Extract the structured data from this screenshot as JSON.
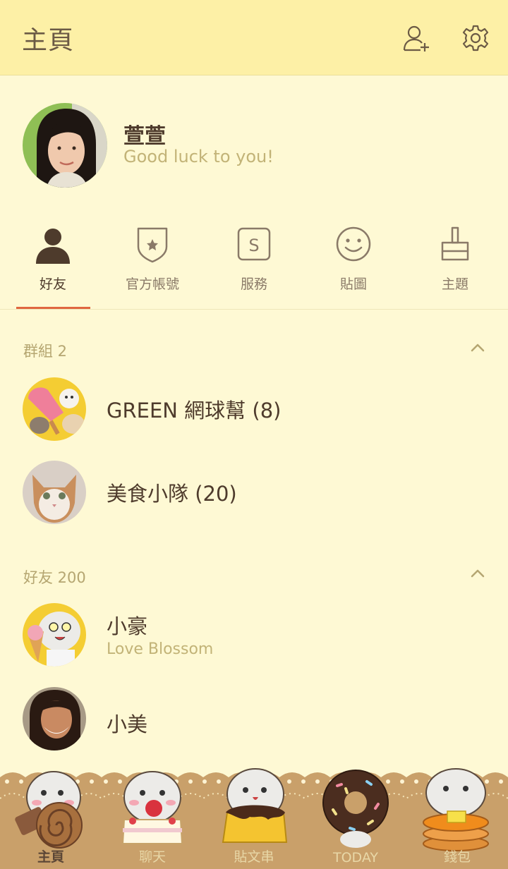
{
  "header": {
    "title": "主頁",
    "add_friend_icon": "add-person-icon",
    "settings_icon": "gear-icon"
  },
  "profile": {
    "name": "萱萱",
    "status": "Good luck to you!"
  },
  "tabs": [
    {
      "label": "好友",
      "icon": "person-icon",
      "active": true
    },
    {
      "label": "官方帳號",
      "icon": "shield-star-icon"
    },
    {
      "label": "服務",
      "icon": "service-s-icon"
    },
    {
      "label": "貼圖",
      "icon": "smiley-icon"
    },
    {
      "label": "主題",
      "icon": "paint-brush-icon"
    }
  ],
  "groups": {
    "title": "群組 2",
    "items": [
      {
        "name": "GREEN 網球幫 (8)"
      },
      {
        "name": "美食小隊 (20)"
      }
    ]
  },
  "friends": {
    "title": "好友 200",
    "items": [
      {
        "name": "小豪",
        "status": "Love Blossom"
      },
      {
        "name": "小美"
      }
    ]
  },
  "bottom_nav": [
    {
      "label": "主頁",
      "active": true
    },
    {
      "label": "聊天"
    },
    {
      "label": "貼文串"
    },
    {
      "label": "TODAY"
    },
    {
      "label": "錢包"
    }
  ],
  "colors": {
    "header_bg": "#fdf0a6",
    "page_bg": "#fef9d4",
    "accent": "#e0663f",
    "footer_bg": "#c9a06a"
  }
}
